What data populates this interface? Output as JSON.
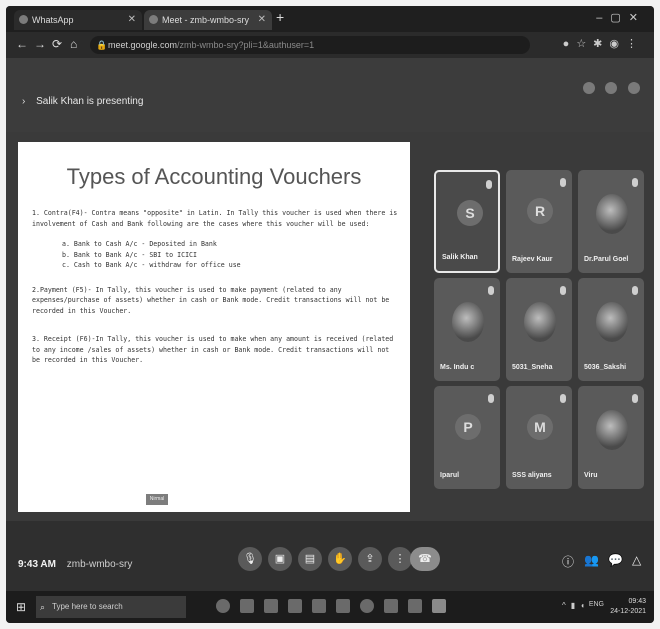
{
  "browser": {
    "tabs": [
      {
        "label": "WhatsApp",
        "icon": "whatsapp-icon"
      },
      {
        "label": "Meet - zmb-wmbo-sry",
        "icon": "meet-icon"
      }
    ],
    "new_tab": "+",
    "url_host": "meet.google.com",
    "url_path": "/zmb-wmbo-sry?pli=1&authuser=1"
  },
  "meet": {
    "presenting_label": "Salik Khan is presenting",
    "meeting_time": "9:43 AM",
    "meeting_code": "zmb-wmbo-sry"
  },
  "slide": {
    "title": "Types of Accounting Vouchers",
    "para1": "1. Contra(F4)- Contra means \"opposite\" in Latin. In Tally this voucher is used when there is involvement of Cash and Bank following are the cases where this voucher will be used:",
    "items": [
      "a. Bank to Cash A/c - Deposited in Bank",
      "b. Bank to Bank A/c - SBI to ICICI",
      "c. Cash to Bank A/c - withdraw for office use"
    ],
    "para2": "2.Payment (F5)- In Tally, this voucher is used to make payment (related to any expenses/purchase of assets) whether in cash or Bank mode. Credit transactions will not be recorded in this Voucher.",
    "para3": "3. Receipt (F6)-In Tally, this voucher is used to make when any amount is received (related to any income /sales of assets) whether in cash or Bank mode. Credit transactions will not be recorded in this Voucher.",
    "tag": "Nirmal"
  },
  "participants": [
    {
      "name": "Salik Khan",
      "initial": "S",
      "active": true
    },
    {
      "name": "Rajeev Kaur",
      "initial": "R",
      "active": false
    },
    {
      "name": "Dr.Parul Goel",
      "initial": "",
      "active": false
    },
    {
      "name": "Ms. Indu c",
      "initial": "",
      "active": false
    },
    {
      "name": "5031_Sneha",
      "initial": "",
      "active": false
    },
    {
      "name": "5036_Sakshi",
      "initial": "",
      "active": false
    },
    {
      "name": "Iparul",
      "initial": "P",
      "active": false
    },
    {
      "name": "SSS aliyans",
      "initial": "M",
      "active": false
    },
    {
      "name": "Viru",
      "initial": "",
      "active": false
    }
  ],
  "taskbar": {
    "search_placeholder": "Type here to search",
    "time": "09:43",
    "date": "24-12-2021",
    "lang": "ENG"
  }
}
